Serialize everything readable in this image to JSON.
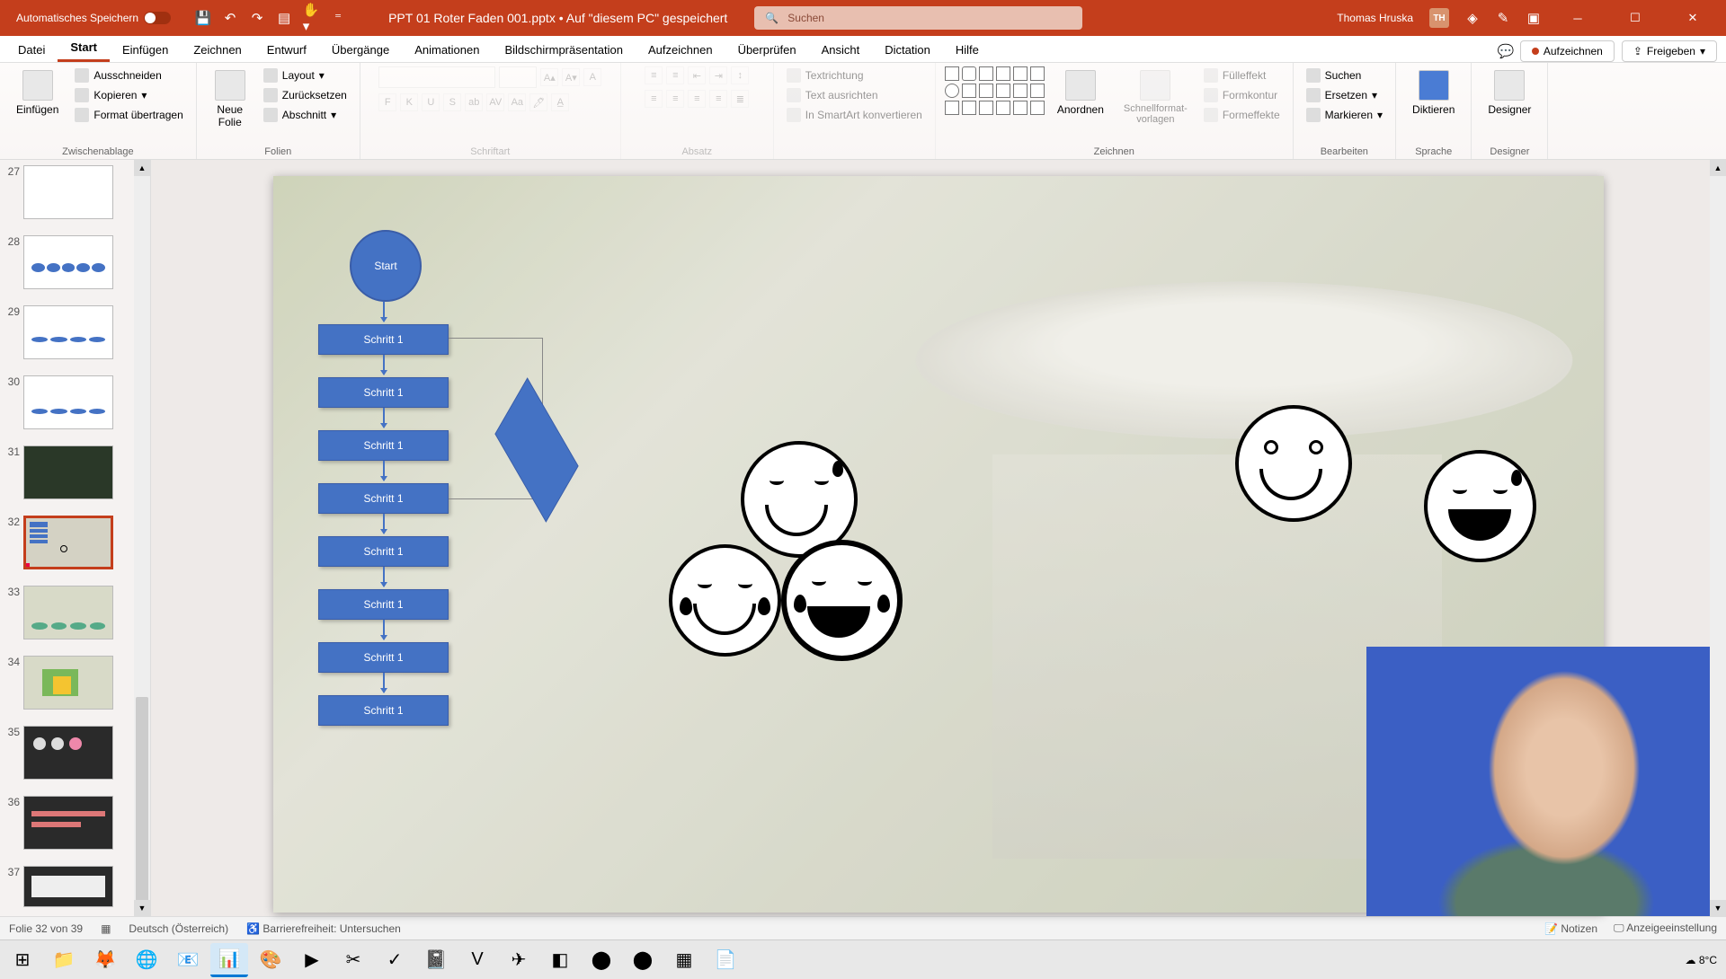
{
  "titleBar": {
    "autosave": "Automatisches Speichern",
    "fileName": "PPT 01 Roter Faden 001.pptx • Auf \"diesem PC\" gespeichert",
    "searchPlaceholder": "Suchen",
    "userName": "Thomas Hruska",
    "userInitials": "TH"
  },
  "tabs": {
    "datei": "Datei",
    "start": "Start",
    "einfuegen": "Einfügen",
    "zeichnen": "Zeichnen",
    "entwurf": "Entwurf",
    "ubergange": "Übergänge",
    "animationen": "Animationen",
    "bildschirm": "Bildschirmpräsentation",
    "aufzeichnen": "Aufzeichnen",
    "uberprufen": "Überprüfen",
    "ansicht": "Ansicht",
    "dictation": "Dictation",
    "hilfe": "Hilfe",
    "aufzeichnenBtn": "Aufzeichnen",
    "freigeben": "Freigeben"
  },
  "ribbon": {
    "einfuegen": "Einfügen",
    "ausschneiden": "Ausschneiden",
    "kopieren": "Kopieren",
    "formatUbertragen": "Format übertragen",
    "zwischenablage": "Zwischenablage",
    "neueFolie": "Neue\nFolie",
    "layout": "Layout",
    "zurucksetzen": "Zurücksetzen",
    "abschnitt": "Abschnitt",
    "folien": "Folien",
    "schriftart": "Schriftart",
    "absatz": "Absatz",
    "textrichtung": "Textrichtung",
    "textAusrichten": "Text ausrichten",
    "smartart": "In SmartArt konvertieren",
    "anordnen": "Anordnen",
    "schnellformat": "Schnellformat-\nvorlagen",
    "fulleffekt": "Fülleffekt",
    "formkontur": "Formkontur",
    "formeffekte": "Formeffekte",
    "zeichnenGroup": "Zeichnen",
    "suchen": "Suchen",
    "ersetzen": "Ersetzen",
    "markieren": "Markieren",
    "bearbeiten": "Bearbeiten",
    "diktieren": "Diktieren",
    "sprache": "Sprache",
    "designer": "Designer",
    "designerGroup": "Designer"
  },
  "thumbs": {
    "n27": "27",
    "n28": "28",
    "n29": "29",
    "n30": "30",
    "n31": "31",
    "n32": "32",
    "n33": "33",
    "n34": "34",
    "n35": "35",
    "n36": "36",
    "n37": "37"
  },
  "slide": {
    "start": "Start",
    "schritt1": "Schritt 1"
  },
  "status": {
    "slideCount": "Folie 32 von 39",
    "language": "Deutsch (Österreich)",
    "accessibility": "Barrierefreiheit: Untersuchen",
    "notizen": "Notizen",
    "anzeige": "Anzeigeeinstellung"
  },
  "taskbar": {
    "temp": "8°C"
  }
}
